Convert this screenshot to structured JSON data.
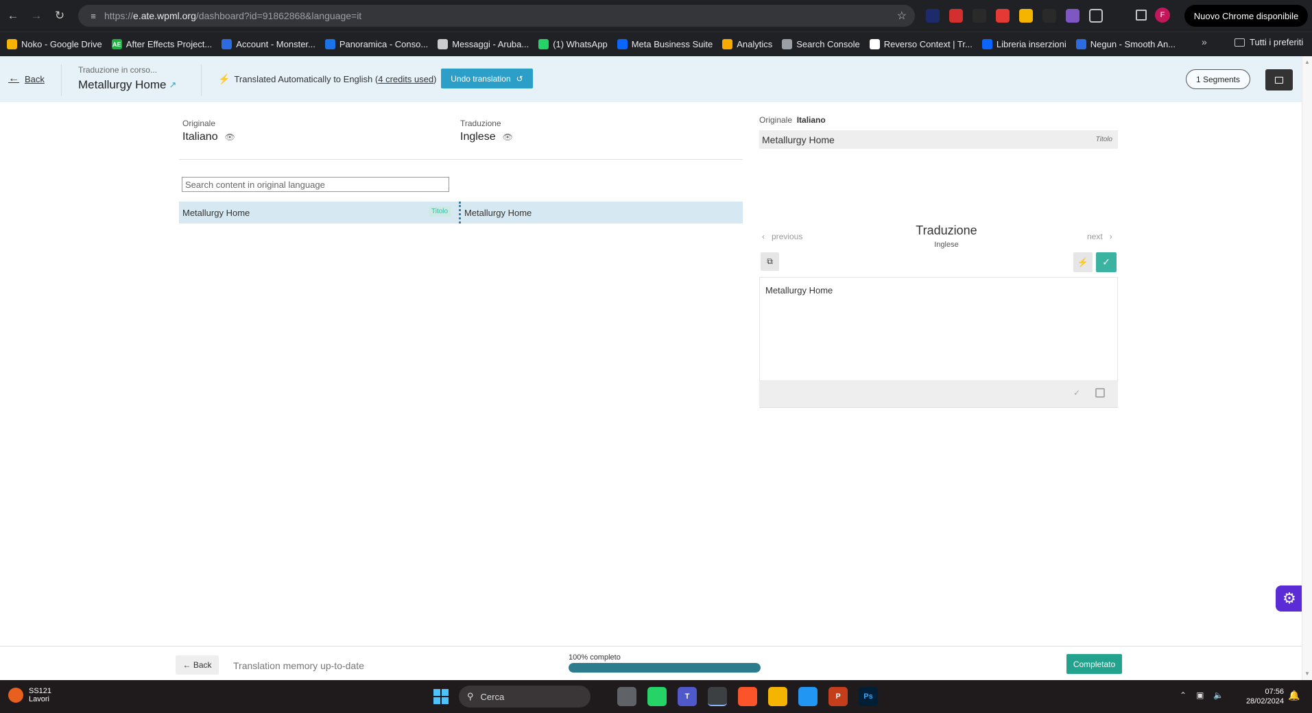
{
  "browser": {
    "url_prefix": "https://",
    "url_host": "e.ate.wpml.org",
    "url_path": "/dashboard?id=91862868&language=it",
    "update_label": "Nuovo Chrome disponibile",
    "profile_initial": "F",
    "bookmarks": [
      {
        "label": "Noko - Google Drive",
        "icon": "drive-icon",
        "color": "#f4b400",
        "glyph": ""
      },
      {
        "label": "After Effects Project...",
        "icon": "ae-icon",
        "color": "#1fb141",
        "glyph": "AE"
      },
      {
        "label": "Account - Monster...",
        "icon": "shield-icon",
        "color": "#2d6be0",
        "glyph": ""
      },
      {
        "label": "Panoramica - Conso...",
        "icon": "doc-icon",
        "color": "#1a73e8",
        "glyph": ""
      },
      {
        "label": "Messaggi - Aruba...",
        "icon": "mail-icon",
        "color": "#cccccc",
        "glyph": ""
      },
      {
        "label": "(1) WhatsApp",
        "icon": "whatsapp-icon",
        "color": "#25d366",
        "glyph": ""
      },
      {
        "label": "Meta Business Suite",
        "icon": "meta-icon",
        "color": "#0a66ff",
        "glyph": ""
      },
      {
        "label": "Analytics",
        "icon": "analytics-icon",
        "color": "#f9ab00",
        "glyph": ""
      },
      {
        "label": "Search Console",
        "icon": "search-console-icon",
        "color": "#9aa0a6",
        "glyph": ""
      },
      {
        "label": "Reverso Context | Tr...",
        "icon": "reverso-icon",
        "color": "#ffffff",
        "glyph": ""
      },
      {
        "label": "Libreria inserzioni",
        "icon": "meta-icon",
        "color": "#0a66ff",
        "glyph": ""
      },
      {
        "label": "Negun - Smooth An...",
        "icon": "shield-icon",
        "color": "#2d6be0",
        "glyph": ""
      }
    ],
    "bookmarks_folder": "Tutti i preferiti"
  },
  "header": {
    "back_label": "Back",
    "job_status": "Traduzione in corso...",
    "job_title": "Metallurgy Home",
    "auto_msg_prefix": "Translated Automatically to English (",
    "auto_msg_credits": "4 credits used",
    "auto_msg_suffix": ")",
    "undo_label": "Undo translation",
    "segments_label": "1 Segments"
  },
  "editor": {
    "original_label": "Originale",
    "original_lang": "Italiano",
    "translation_label": "Traduzione",
    "translation_lang": "Inglese",
    "search_placeholder": "Search content in original language",
    "segments": [
      {
        "original": "Metallurgy Home",
        "tag": "Titolo",
        "translation": "Metallurgy Home"
      }
    ]
  },
  "panel": {
    "original_label": "Originale",
    "original_lang": "Italiano",
    "original_text": "Metallurgy Home",
    "original_tag": "Titolo",
    "prev_label": "previous",
    "next_label": "next",
    "title": "Traduzione",
    "subtitle": "Inglese",
    "translation_text": "Metallurgy Home"
  },
  "footer": {
    "back_label": "← Back",
    "tm_status": "Translation memory up-to-date",
    "progress_label": "100% completo",
    "progress_value": 100,
    "complete_label": "Completato"
  },
  "taskbar": {
    "weather_title": "SS121",
    "weather_sub": "Lavori",
    "search_label": "Cerca",
    "time": "07:56",
    "date": "28/02/2024"
  }
}
